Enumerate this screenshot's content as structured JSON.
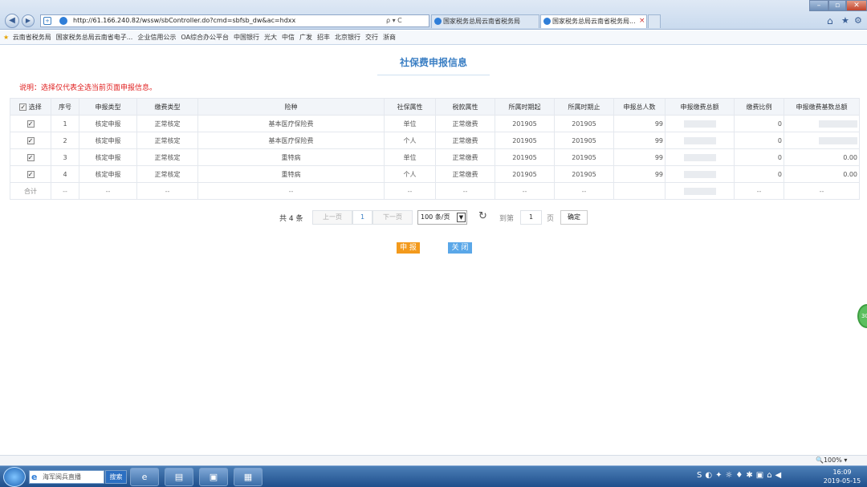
{
  "browser": {
    "url": "http://61.166.240.82/wssw/sbController.do?cmd=sbfsb_dw&ac=hdxx",
    "search_glyph": "ρ ▾ C",
    "tabs": [
      {
        "label": "国家税务总局云南省税务局",
        "active": false
      },
      {
        "label": "国家税务总局云南省税务局...",
        "active": true
      }
    ],
    "tab_close": "×",
    "favorites": [
      "云南省税务局",
      "国家税务总局云南省电子...",
      "企业信用公示",
      "OA综合办公平台",
      "中国银行",
      "光大",
      "中信",
      "广发",
      "招丰",
      "北京银行",
      "交行",
      "浙商"
    ]
  },
  "page": {
    "title": "社保费申报信息",
    "note": "说明：选择仅代表全选当前页面申报信息。",
    "table": {
      "select_all_label": "选择",
      "headers": [
        "序号",
        "申报类型",
        "缴费类型",
        "险种",
        "社保属性",
        "税款属性",
        "所属时期起",
        "所属时期止",
        "申报总人数",
        "申报缴费总额",
        "缴费比例",
        "申报缴费基数总额"
      ],
      "rows": [
        {
          "no": "1",
          "sb_type": "核定申报",
          "jf_type": "正常核定",
          "xz": "基本医疗保险费",
          "sb_attr": "单位",
          "sk_attr": "正常缴费",
          "start": "201905",
          "end": "201905",
          "people": "99",
          "total": "",
          "ratio": "0",
          "base": ""
        },
        {
          "no": "2",
          "sb_type": "核定申报",
          "jf_type": "正常核定",
          "xz": "基本医疗保险费",
          "sb_attr": "个人",
          "sk_attr": "正常缴费",
          "start": "201905",
          "end": "201905",
          "people": "99",
          "total": "",
          "ratio": "0",
          "base": ""
        },
        {
          "no": "3",
          "sb_type": "核定申报",
          "jf_type": "正常核定",
          "xz": "重特病",
          "sb_attr": "单位",
          "sk_attr": "正常缴费",
          "start": "201905",
          "end": "201905",
          "people": "99",
          "total": "",
          "ratio": "0",
          "base": "0.00"
        },
        {
          "no": "4",
          "sb_type": "核定申报",
          "jf_type": "正常核定",
          "xz": "重特病",
          "sb_attr": "个人",
          "sk_attr": "正常缴费",
          "start": "201905",
          "end": "201905",
          "people": "99",
          "total": "",
          "ratio": "0",
          "base": "0.00"
        }
      ],
      "total_row": {
        "label": "合计",
        "dash": "--"
      }
    },
    "pager": {
      "total_text": "共 4 条",
      "prev": "上一页",
      "current": "1",
      "next": "下一页",
      "page_size": "100 条/页",
      "goto_label": "到第",
      "goto_value": "1",
      "page_unit": "页",
      "confirm": "确定"
    },
    "buttons": {
      "declare": "申 报",
      "close": "关 闭"
    },
    "side_widget": "30"
  },
  "status": {
    "zoom": "100%"
  },
  "taskbar": {
    "search_placeholder": "海军阅兵直播",
    "search_button": "搜索",
    "time": "16:09",
    "date": "2019-05-15"
  }
}
